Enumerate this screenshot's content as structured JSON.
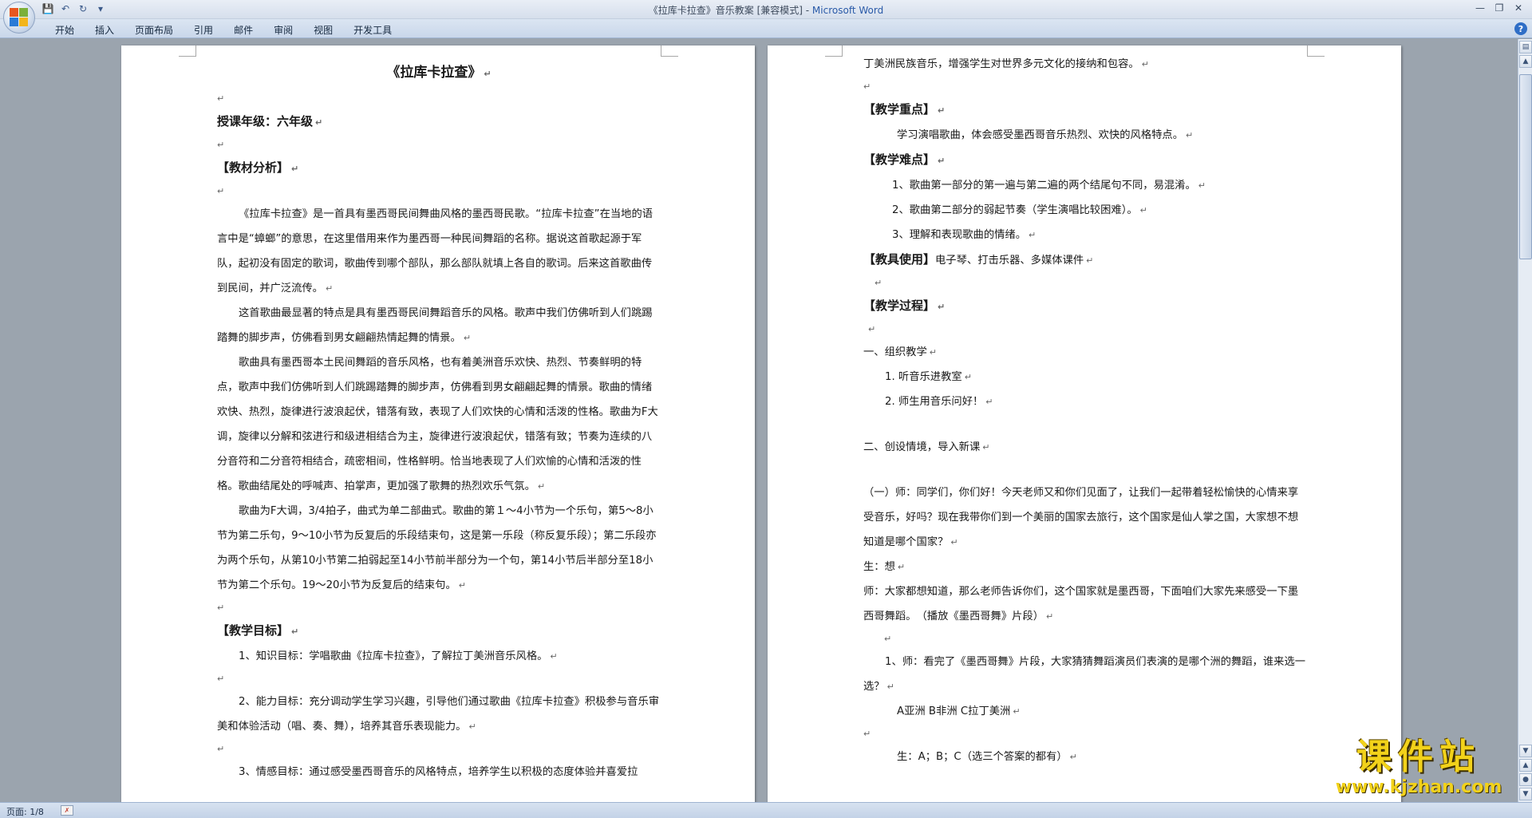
{
  "window": {
    "title_doc": "《拉库卡拉查》音乐教案 [兼容模式] - ",
    "title_app": "Microsoft Word"
  },
  "qat": {
    "icons": [
      "save-icon",
      "undo-icon",
      "redo-icon",
      "customize-icon"
    ]
  },
  "ribbon": {
    "tabs": [
      "开始",
      "插入",
      "页面布局",
      "引用",
      "邮件",
      "审阅",
      "视图",
      "开发工具"
    ]
  },
  "status": {
    "page": "页面: 1/8"
  },
  "left_page": {
    "title": "《拉库卡拉查》",
    "grade": "授课年级：六年级",
    "h_analysis": "【教材分析】",
    "analysis_p1": "《拉库卡拉查》是一首具有墨西哥民间舞曲风格的墨西哥民歌。“拉库卡拉查”在当地的语言中是“蟑螂”的意思，在这里借用来作为墨西哥一种民间舞蹈的名称。据说这首歌起源于军队，起初没有固定的歌词，歌曲传到哪个部队，那么部队就填上各自的歌词。后来这首歌曲传到民间，并广泛流传。",
    "analysis_p2": "这首歌曲最显著的特点是具有墨西哥民间舞蹈音乐的风格。歌声中我们仿佛听到人们跳踢踏舞的脚步声，仿佛看到男女翩翩热情起舞的情景。",
    "analysis_p3": "歌曲具有墨西哥本土民间舞蹈的音乐风格，也有着美洲音乐欢快、热烈、节奏鲜明的特点，歌声中我们仿佛听到人们跳踢踏舞的脚步声，仿佛看到男女翩翩起舞的情景。歌曲的情绪欢快、热烈，旋律进行波浪起伏，错落有致，表现了人们欢快的心情和活泼的性格。歌曲为F大调，旋律以分解和弦进行和级进相结合为主，旋律进行波浪起伏，错落有致；节奏为连续的八分音符和二分音符相结合，疏密相间，性格鲜明。恰当地表现了人们欢愉的心情和活泼的性格。歌曲结尾处的呼喊声、拍掌声，更加强了歌舞的热烈欢乐气氛。",
    "analysis_p4": "歌曲为F大调，3/4拍子，曲式为单二部曲式。歌曲的第１～4小节为一个乐句，第5～8小节为第二乐句，9～10小节为反复后的乐段结束句，这是第一乐段（称反复乐段）；第二乐段亦为两个乐句，从第10小节第二拍弱起至14小节前半部分为一个句，第14小节后半部分至18小节为第二个乐句。19～20小节为反复后的结束句。",
    "h_goals": "【教学目标】",
    "goal1": "1、知识目标：学唱歌曲《拉库卡拉查》，了解拉丁美洲音乐风格。",
    "goal2": "2、能力目标：充分调动学生学习兴趣，引导他们通过歌曲《拉库卡拉查》积极参与音乐审美和体验活动（唱、奏、舞），培养其音乐表现能力。",
    "goal3": "3、情感目标：通过感受墨西哥音乐的风格特点，培养学生以积极的态度体验并喜爱拉"
  },
  "right_page": {
    "cont": "丁美洲民族音乐，增强学生对世界多元文化的接纳和包容。",
    "h_key": "【教学重点】",
    "key_text": "学习演唱歌曲，体会感受墨西哥音乐热烈、欢快的风格特点。",
    "h_diff": "【教学难点】",
    "diff1": "1、歌曲第一部分的第一遍与第二遍的两个结尾句不同，易混淆。",
    "diff2": "2、歌曲第二部分的弱起节奏（学生演唱比较困难）。",
    "diff3": "3、理解和表现歌曲的情绪。",
    "h_tools": "【教具使用】",
    "tools_text": "电子琴、打击乐器、多媒体课件",
    "h_process": "【教学过程】",
    "step1": "一、组织教学",
    "step1_1": "1. 听音乐进教室",
    "step1_2": "2. 师生用音乐问好！",
    "step2": "二、创设情境，导入新课",
    "dialog1": "（一）师：同学们，你们好！今天老师又和你们见面了，让我们一起带着轻松愉快的心情来享受音乐，好吗？现在我带你们到一个美丽的国家去旅行，这个国家是仙人掌之国，大家想不想知道是哪个国家？",
    "dialog2": "生：想",
    "dialog3": "师：大家都想知道，那么老师告诉你们，这个国家就是墨西哥，下面咱们大家先来感受一下墨西哥舞蹈。　（播放《墨西哥舞》片段）",
    "q1": "1、师：看完了《墨西哥舞》片段，大家猜猜舞蹈演员们表演的是哪个洲的舞蹈，谁来选一选？",
    "q1_options": "A亚洲 B非洲 C拉丁美洲",
    "q1_answer": "生：A；B；C（选三个答案的都有）"
  },
  "watermark": {
    "cn": "课件站",
    "url": "www.kjzhan.com"
  }
}
